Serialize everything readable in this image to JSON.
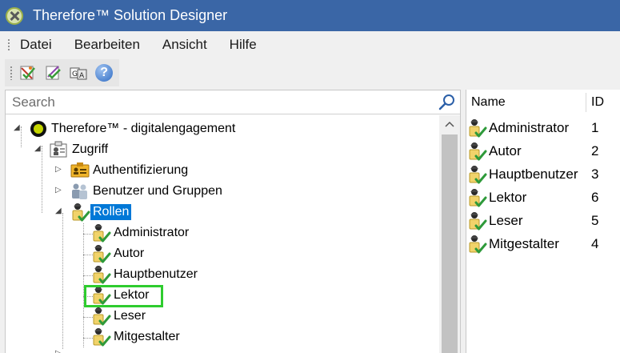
{
  "window": {
    "title": "Therefore™ Solution Designer"
  },
  "menu": {
    "items": [
      "Datei",
      "Bearbeiten",
      "Ansicht",
      "Hilfe"
    ]
  },
  "toolbar": {
    "buttons": [
      "wizard-icon",
      "edit-icon",
      "translate-icon",
      "help-icon"
    ],
    "help_glyph": "?"
  },
  "search": {
    "placeholder": "Search"
  },
  "tree": {
    "root": "Therefore™ - digitalengagement",
    "access": "Zugriff",
    "authentication": "Authentifizierung",
    "users_groups": "Benutzer und Gruppen",
    "roles": "Rollen",
    "role_items": [
      "Administrator",
      "Autor",
      "Hauptbenutzer",
      "Lektor",
      "Leser",
      "Mitgestalter"
    ],
    "selected": "Rollen",
    "focused": "Lektor"
  },
  "list": {
    "columns": [
      "Name",
      "ID"
    ],
    "rows": [
      {
        "name": "Administrator",
        "id": "1"
      },
      {
        "name": "Autor",
        "id": "2"
      },
      {
        "name": "Hauptbenutzer",
        "id": "3"
      },
      {
        "name": "Lektor",
        "id": "6"
      },
      {
        "name": "Leser",
        "id": "5"
      },
      {
        "name": "Mitgestalter",
        "id": "4"
      }
    ]
  },
  "colors": {
    "titlebar": "#3a66a6",
    "selection": "#0078d7",
    "focus_highlight": "#2ecc2e"
  }
}
